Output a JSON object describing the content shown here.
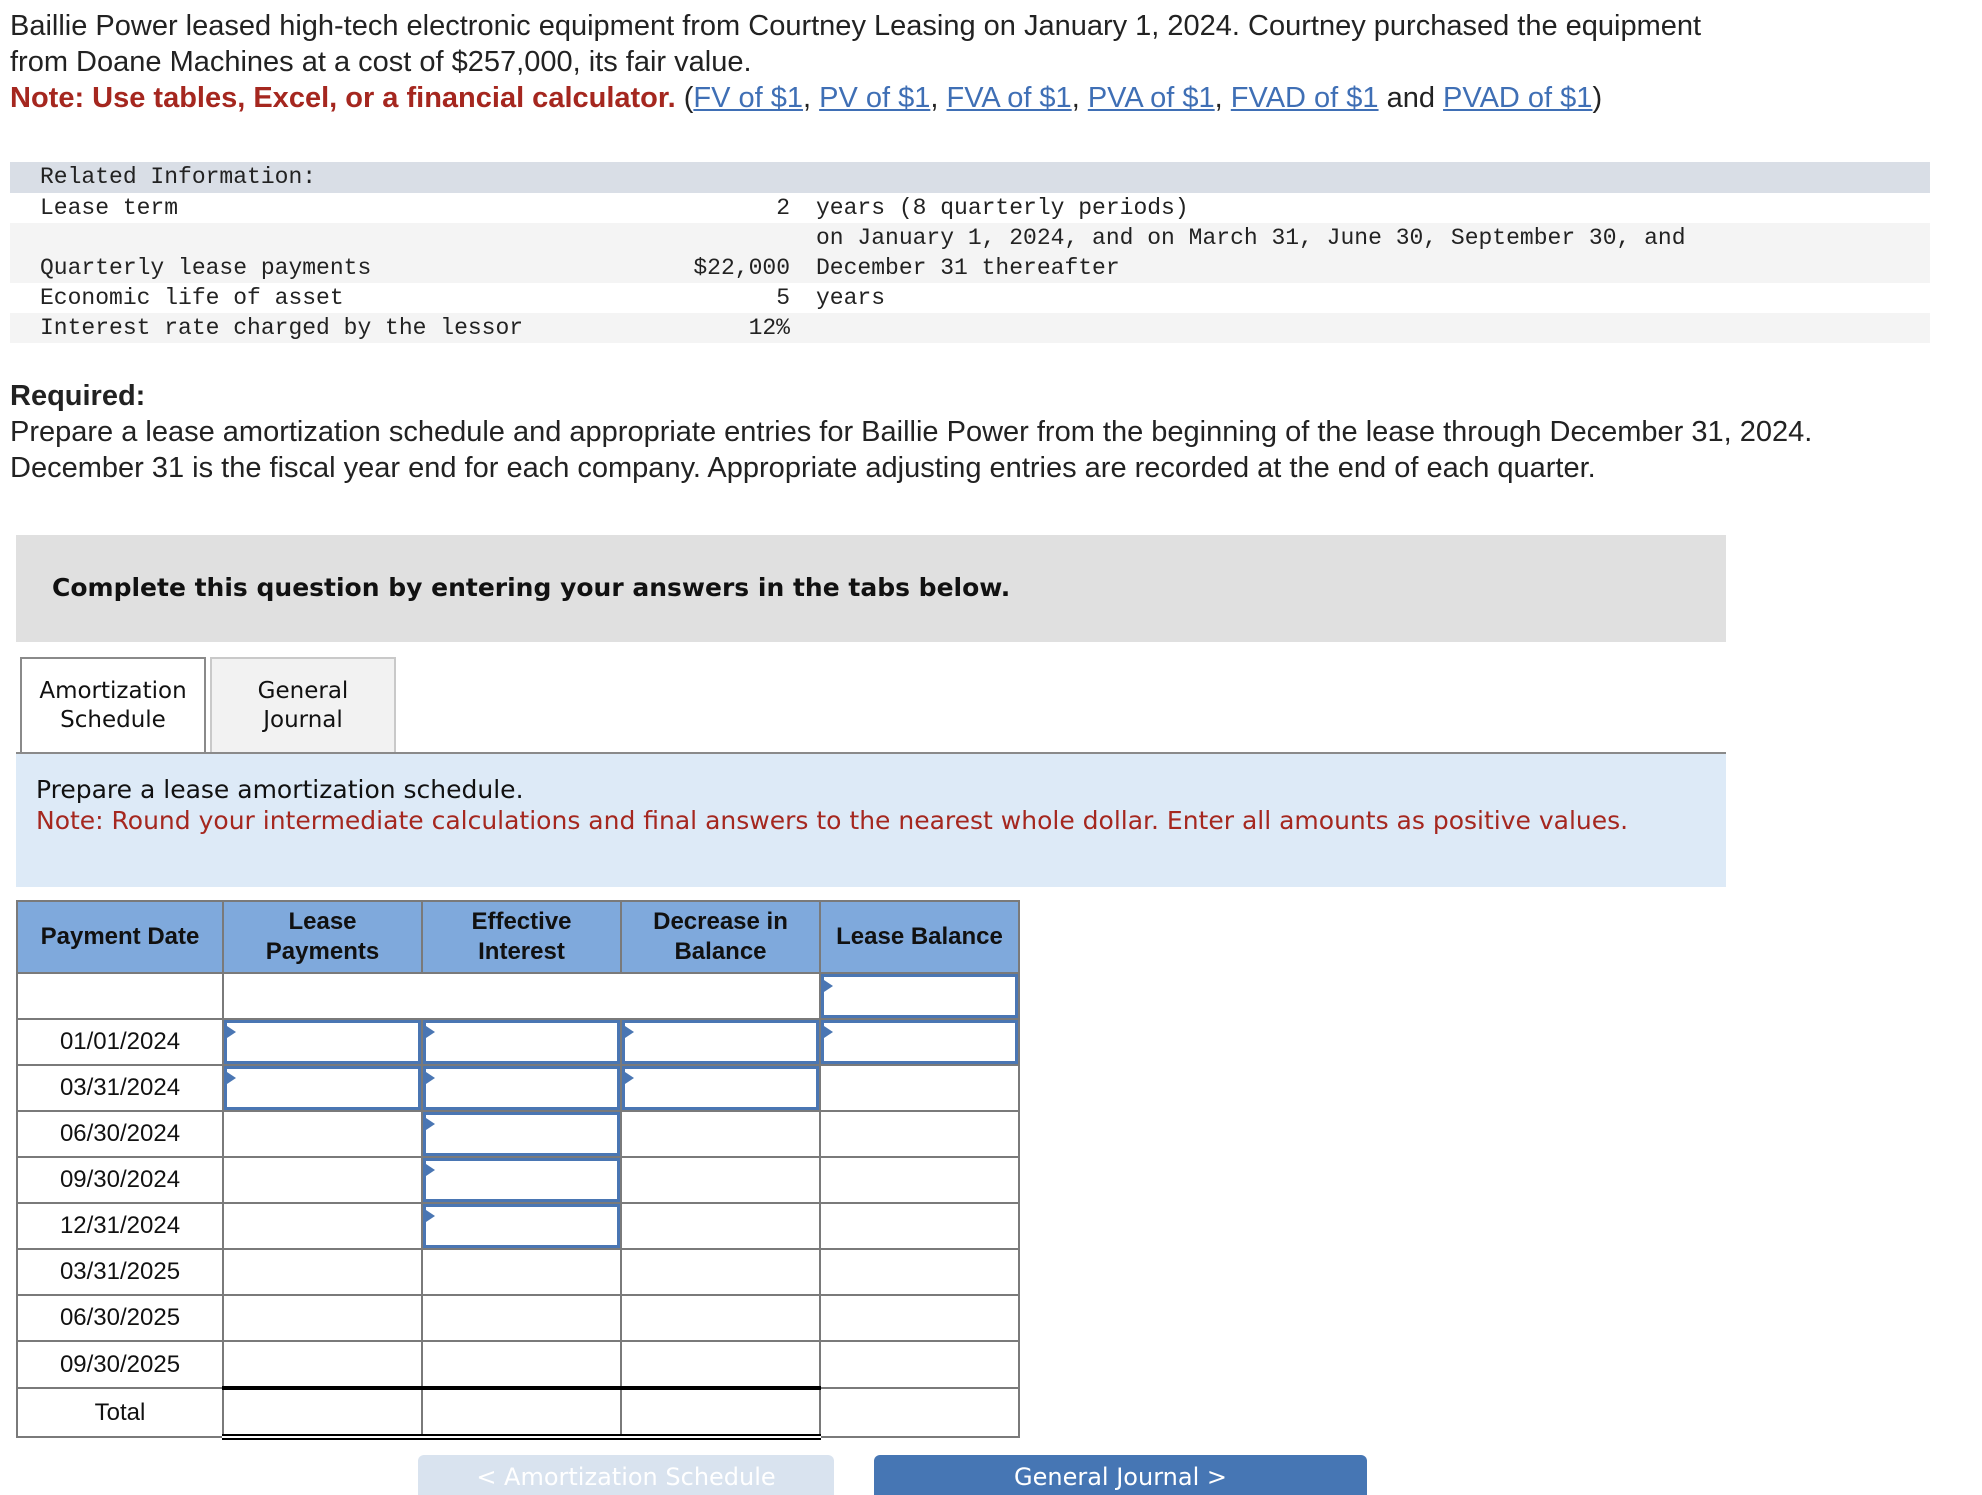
{
  "intro": {
    "line1": "Baillie Power leased high-tech electronic equipment from Courtney Leasing on January 1, 2024. Courtney purchased the equipment",
    "line2": "from Doane Machines at a cost of $257,000, its fair value.",
    "note": "Note: Use tables, Excel, or a financial calculator.",
    "open_paren": " (",
    "links": [
      "FV of $1",
      "PV of $1",
      "FVA of $1",
      "PVA of $1",
      "FVAD of $1",
      "PVAD of $1"
    ],
    "sep": ", ",
    "and": " and ",
    "close_paren": ")"
  },
  "related": {
    "header": "Related Information:",
    "rows": [
      {
        "label": "Lease term",
        "value": "2",
        "desc": "years (8 quarterly periods)"
      },
      {
        "label": "Quarterly lease payments",
        "value": "$22,000",
        "desc_line1": "on January 1, 2024, and on March 31, June 30, September 30, and",
        "desc_line2": "December 31 thereafter"
      },
      {
        "label": "Economic life of asset",
        "value": "5",
        "desc": "years"
      },
      {
        "label": "Interest rate charged by the lessor",
        "value": "12%",
        "desc": ""
      }
    ]
  },
  "required": {
    "title": "Required:",
    "text": "Prepare a lease amortization schedule and appropriate entries for Baillie Power from the beginning of the lease through December 31, 2024. December 31 is the fiscal year end for each company. Appropriate adjusting entries are recorded at the end of each quarter."
  },
  "instructions": "Complete this question by entering your answers in the tabs below.",
  "tabs": [
    {
      "label": "Amortization Schedule",
      "active": true
    },
    {
      "label": "General Journal",
      "active": false
    }
  ],
  "info": {
    "prompt": "Prepare a lease amortization schedule.",
    "note": "Note: Round your intermediate calculations and final answers to the nearest whole dollar. Enter all amounts as positive values."
  },
  "schedule": {
    "headers": [
      "Payment Date",
      "Lease Payments",
      "Effective Interest",
      "Decrease in Balance",
      "Lease Balance"
    ],
    "rows": [
      {
        "date": "",
        "lease_payment": "",
        "effective_interest": "",
        "decrease": "",
        "balance": ""
      },
      {
        "date": "01/01/2024",
        "lease_payment": "",
        "effective_interest": "",
        "decrease": "",
        "balance": ""
      },
      {
        "date": "03/31/2024",
        "lease_payment": "",
        "effective_interest": "",
        "decrease": "",
        "balance": ""
      },
      {
        "date": "06/30/2024",
        "lease_payment": "",
        "effective_interest": "",
        "decrease": "",
        "balance": ""
      },
      {
        "date": "09/30/2024",
        "lease_payment": "",
        "effective_interest": "",
        "decrease": "",
        "balance": ""
      },
      {
        "date": "12/31/2024",
        "lease_payment": "",
        "effective_interest": "",
        "decrease": "",
        "balance": ""
      },
      {
        "date": "03/31/2025",
        "lease_payment": "",
        "effective_interest": "",
        "decrease": "",
        "balance": ""
      },
      {
        "date": "06/30/2025",
        "lease_payment": "",
        "effective_interest": "",
        "decrease": "",
        "balance": ""
      },
      {
        "date": "09/30/2025",
        "lease_payment": "",
        "effective_interest": "",
        "decrease": "",
        "balance": ""
      }
    ],
    "total_label": "Total"
  },
  "nav": {
    "prev_label": "< Amortization Schedule",
    "next_label": "General Journal >"
  },
  "colors": {
    "note_red": "#a5271f",
    "link_blue": "#3f6fb5",
    "header_blue": "#7fa9dc",
    "input_border": "#4a76b3",
    "next_button": "#4676b4"
  }
}
